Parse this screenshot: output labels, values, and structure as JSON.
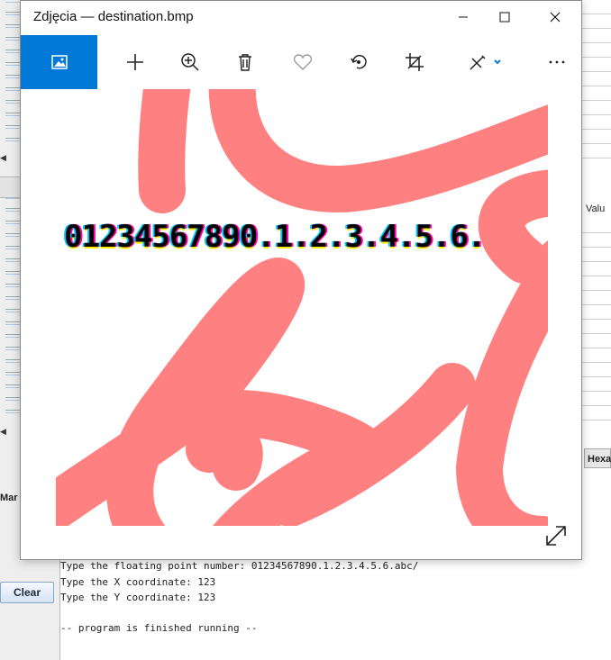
{
  "window": {
    "title": "Zdjęcia — destination.bmp"
  },
  "toolbar": {
    "items": [
      {
        "icon": "image-icon"
      },
      {
        "icon": "plus-icon"
      },
      {
        "icon": "zoom-in-icon"
      },
      {
        "icon": "trash-icon"
      },
      {
        "icon": "heart-icon"
      },
      {
        "icon": "rotate-icon"
      },
      {
        "icon": "crop-icon"
      },
      {
        "icon": "edit-draw-icon"
      },
      {
        "icon": "more-icon"
      }
    ]
  },
  "image": {
    "text": "01234567890.1.2.3.4.5.6.",
    "stroke_color": "#ff8080"
  },
  "background_app": {
    "header_valu": "Valu",
    "button_hexa": "Hexa",
    "label_mar": "Mar",
    "clear_button": "Clear",
    "console_lines": [
      "Type the floating point number: 01234567890.1.2.3.4.5.6.abc/",
      "Type the X coordinate: 123",
      "Type the Y coordinate: 123",
      "",
      "-- program is finished running --"
    ]
  },
  "colors": {
    "accent": "#0078d7"
  }
}
